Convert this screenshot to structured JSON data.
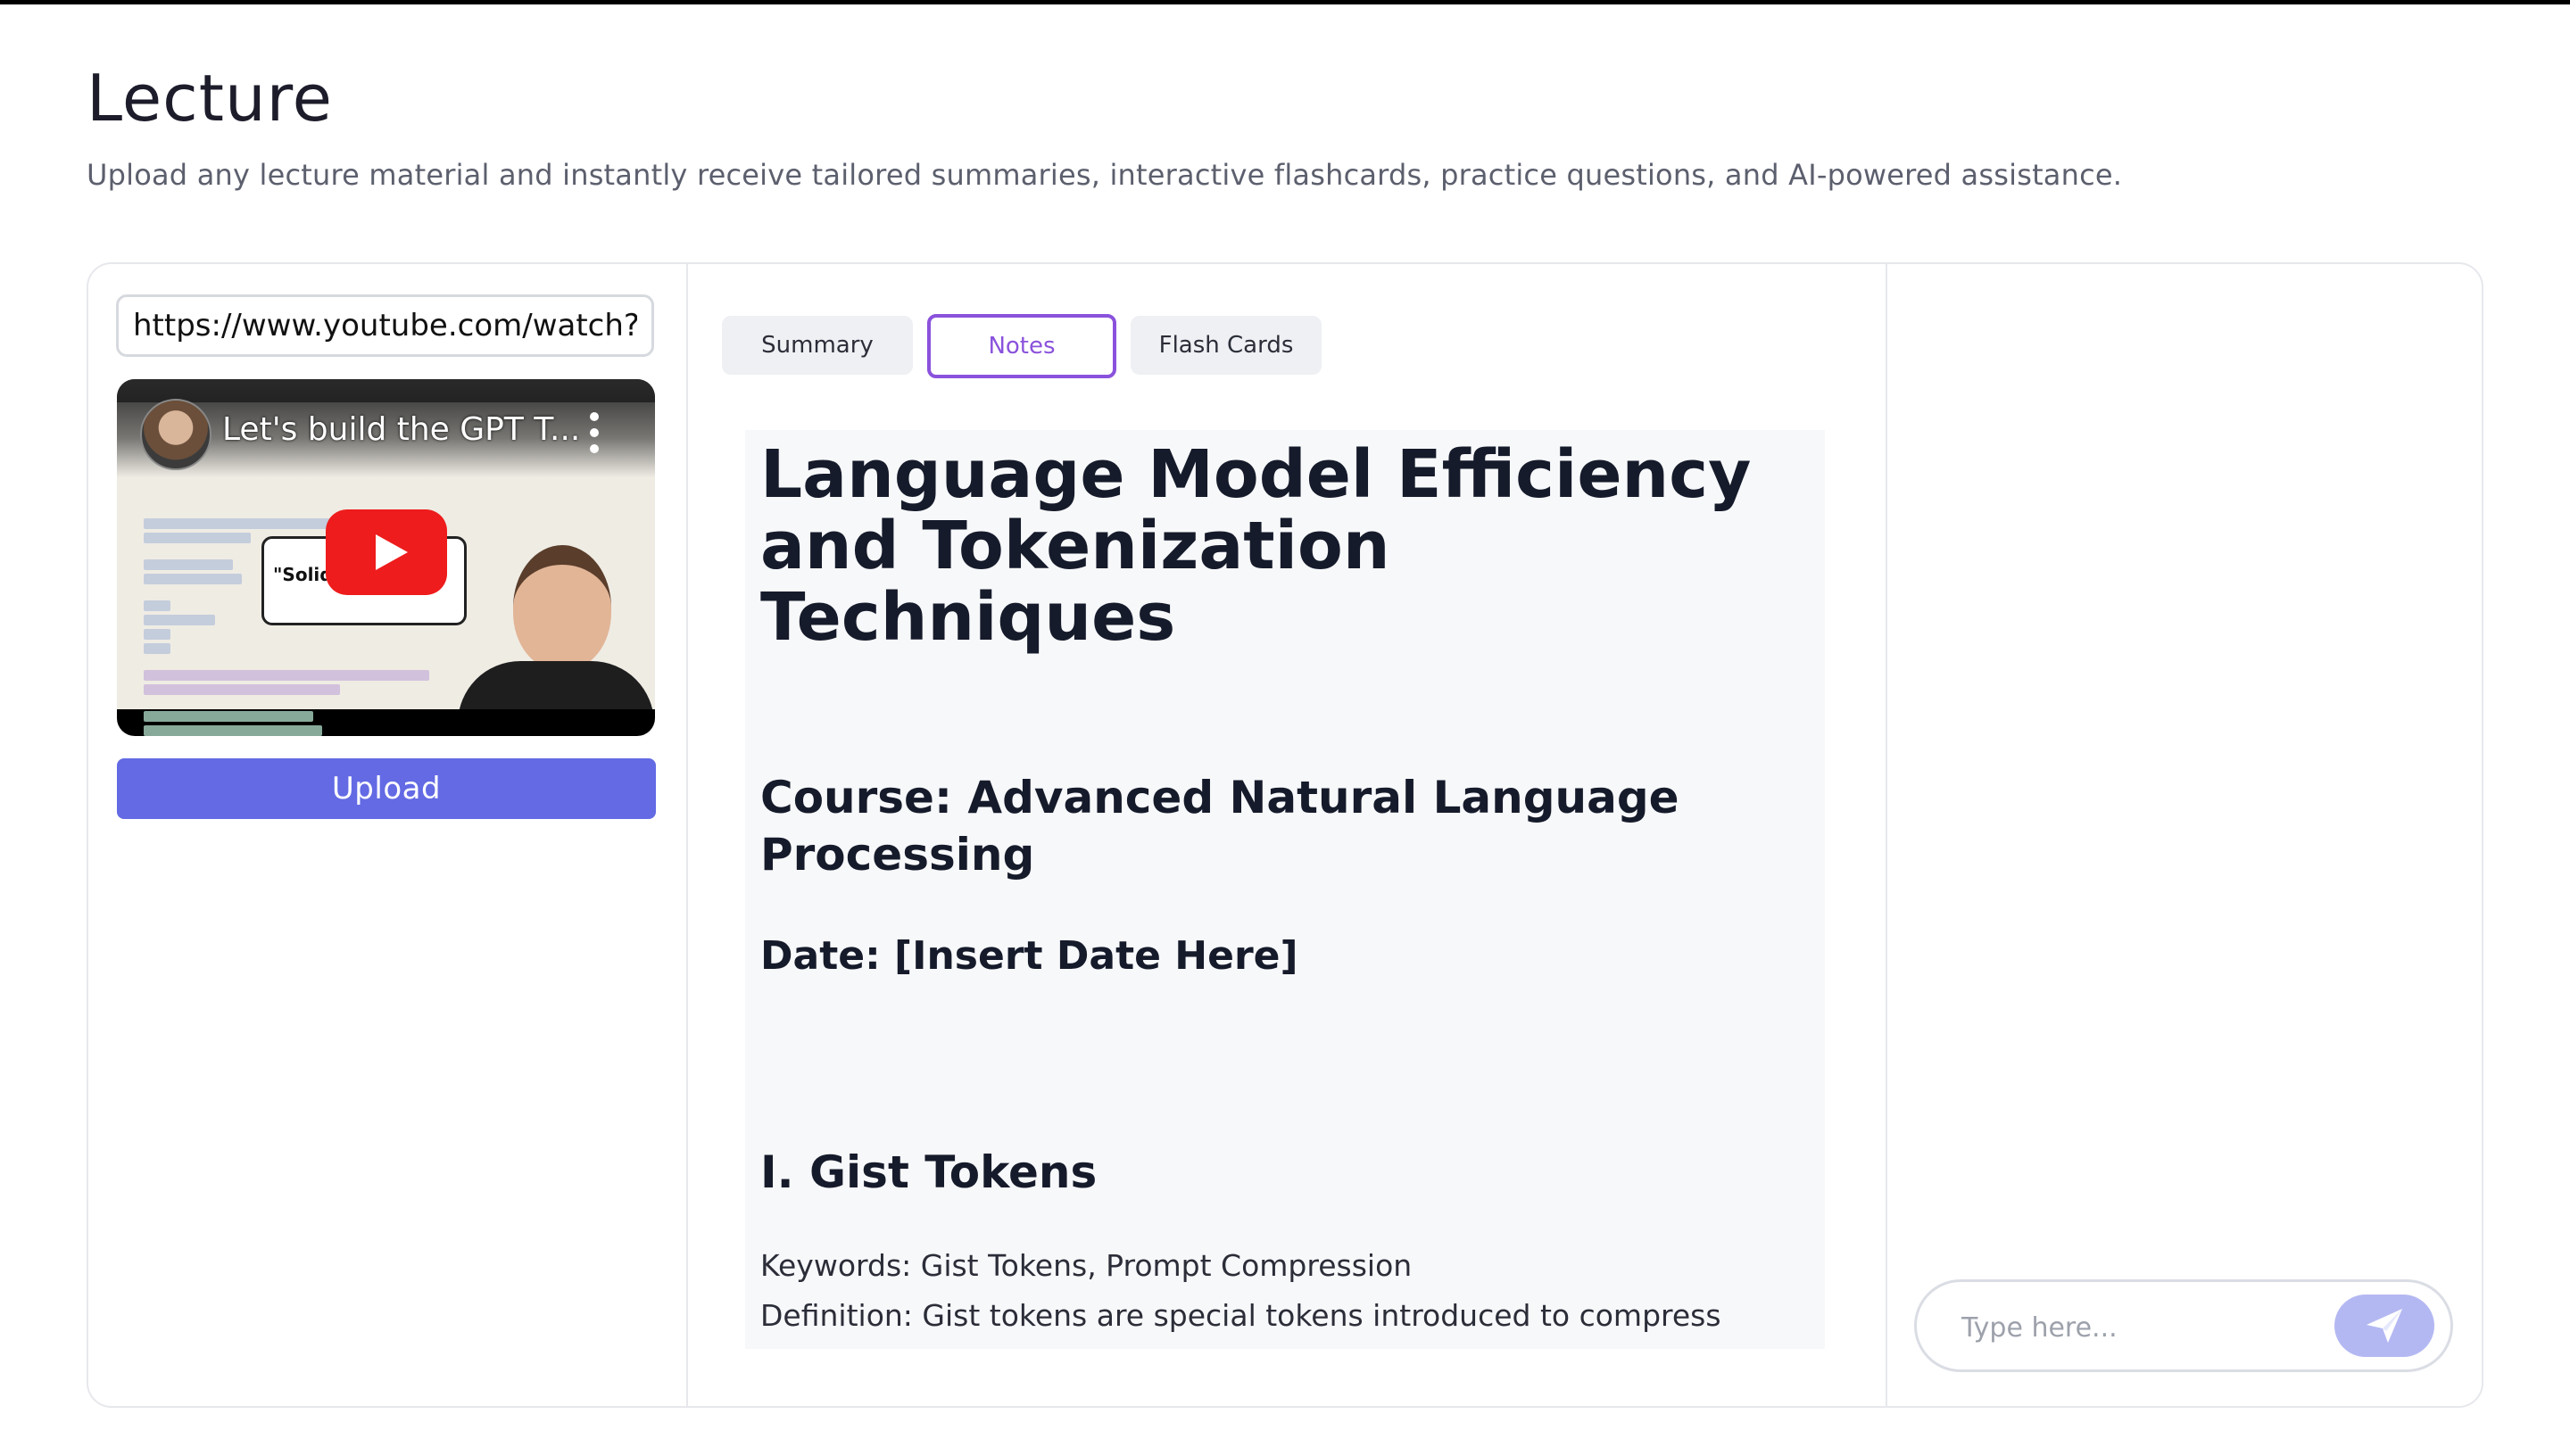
{
  "page": {
    "title": "Lecture",
    "subtitle": "Upload any lecture material and instantly receive tailored summaries, interactive flashcards, practice questions, and AI-powered assistance."
  },
  "left_panel": {
    "url_value": "https://www.youtube.com/watch?",
    "video": {
      "title": "Let's build the GPT T...",
      "bubble_text": "\"Solid",
      "icons": [
        "channel-avatar",
        "kebab-menu-icon",
        "youtube-play-icon"
      ],
      "play_button_color": "#ee1c1c"
    },
    "upload_label": "Upload",
    "upload_color": "#636ae4"
  },
  "middle_panel": {
    "tabs": [
      {
        "label": "Summary",
        "active": false
      },
      {
        "label": "Notes",
        "active": true
      },
      {
        "label": "Flash Cards",
        "active": false
      }
    ],
    "active_tab_color": "#8a52dc",
    "notes": {
      "heading": "Language Model Efficiency and Tokenization Techniques",
      "course": "Course: Advanced Natural Language Processing",
      "date": "Date: [Insert Date Here]",
      "section_heading": "I. Gist Tokens",
      "keywords": "Keywords: Gist Tokens, Prompt Compression",
      "definition": "Definition: Gist tokens are special tokens introduced to compress"
    }
  },
  "right_panel": {
    "chat_placeholder": "Type here...",
    "send_icon": "paper-plane-icon",
    "send_color": "#b4b8f2"
  }
}
